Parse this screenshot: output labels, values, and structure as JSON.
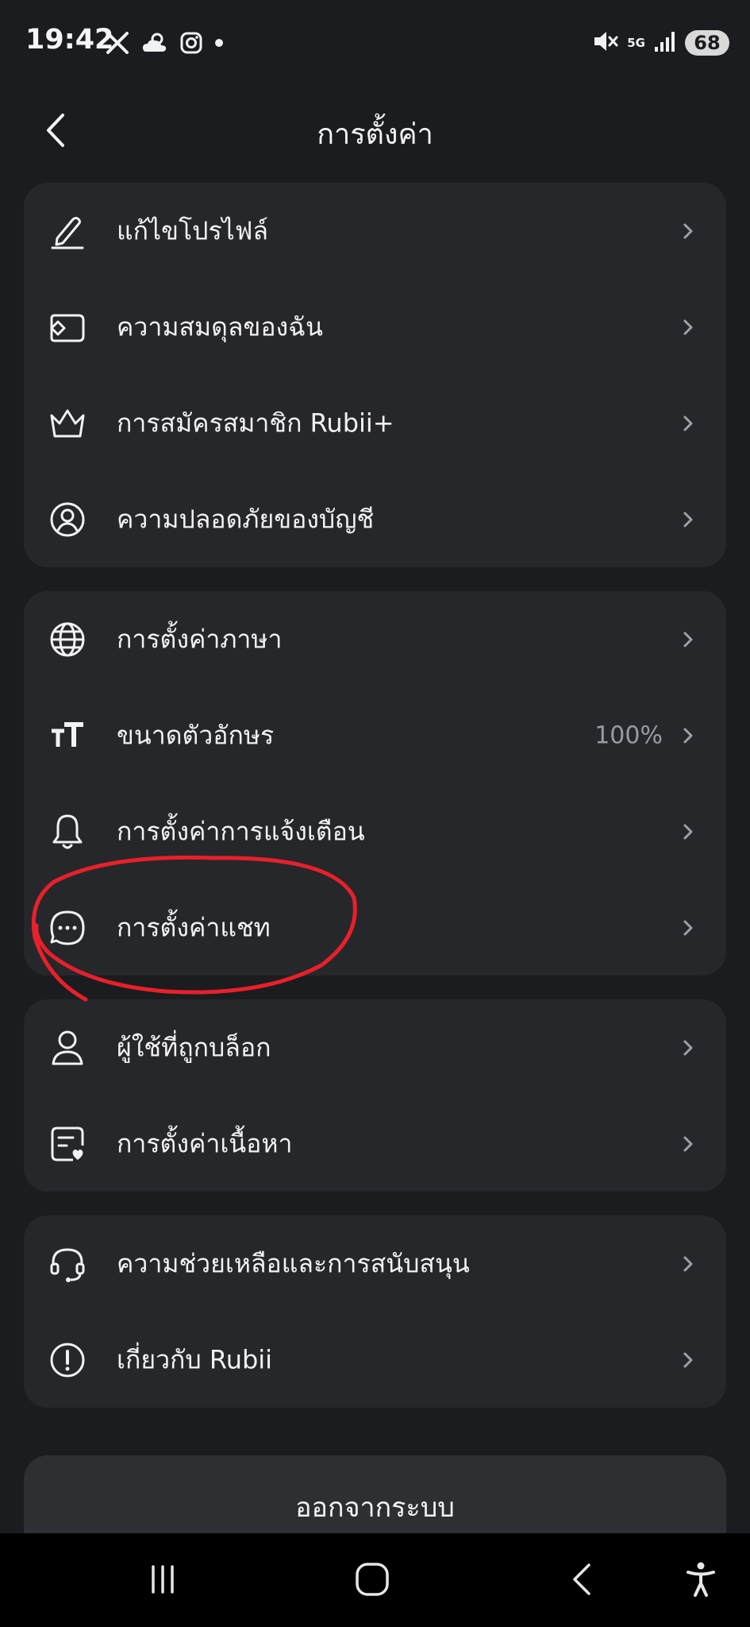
{
  "status_bar": {
    "time": "19:42",
    "network": "5G",
    "battery": "68",
    "icons": [
      "x-icon",
      "weather-icon",
      "instagram-icon",
      "dot-icon",
      "mute-icon",
      "signal-icon"
    ]
  },
  "header": {
    "title": "การตั้งค่า",
    "back_icon": "chevron-left-icon"
  },
  "groups": [
    {
      "items": [
        {
          "id": "edit-profile",
          "icon": "pencil-icon",
          "label": "แก้ไขโปรไฟล์"
        },
        {
          "id": "my-balance",
          "icon": "wallet-icon",
          "label": "ความสมดุลของฉัน"
        },
        {
          "id": "subscription",
          "icon": "crown-icon",
          "label": "การสมัครสมาชิก Rubii+"
        },
        {
          "id": "account-security",
          "icon": "user-circle-icon",
          "label": "ความปลอดภัยของบัญชี"
        }
      ]
    },
    {
      "items": [
        {
          "id": "language",
          "icon": "globe-icon",
          "label": "การตั้งค่าภาษา"
        },
        {
          "id": "font-size",
          "icon": "text-size-icon",
          "label": "ขนาดตัวอักษร",
          "value": "100%"
        },
        {
          "id": "notifications",
          "icon": "bell-icon",
          "label": "การตั้งค่าการแจ้งเตือน"
        },
        {
          "id": "chat",
          "icon": "chat-bubble-icon",
          "label": "การตั้งค่าแชท"
        }
      ]
    },
    {
      "items": [
        {
          "id": "blocked-users",
          "icon": "person-icon",
          "label": "ผู้ใช้ที่ถูกบล็อก"
        },
        {
          "id": "content",
          "icon": "content-icon",
          "label": "การตั้งค่าเนื้อหา"
        }
      ]
    },
    {
      "items": [
        {
          "id": "help",
          "icon": "headset-icon",
          "label": "ความช่วยเหลือและการสนับสนุน"
        },
        {
          "id": "about",
          "icon": "info-icon",
          "label": "เกี่ยวกับ Rubii"
        }
      ]
    }
  ],
  "logout": {
    "label": "ออกจากระบบ"
  },
  "nav_bar": {
    "icons": [
      "recent-apps-icon",
      "home-icon",
      "back-icon",
      "accessibility-icon"
    ]
  },
  "colors": {
    "background": "#1b1c1f",
    "card": "#26272b",
    "text": "#f2f2f4",
    "secondary_text": "#9a9ba0",
    "annotation": "#e8202a"
  }
}
